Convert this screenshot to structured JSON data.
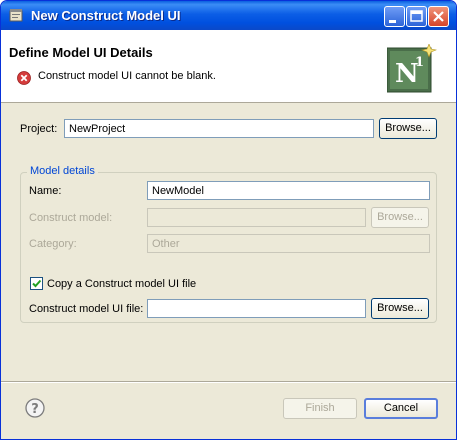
{
  "window": {
    "title": "New Construct Model UI"
  },
  "header": {
    "title": "Define Model UI Details",
    "error_message": "Construct model UI cannot be blank.",
    "wizard_image_text": "N",
    "wizard_image_superscript": "1"
  },
  "project": {
    "label": "Project:",
    "value": "NewProject",
    "browse_label": "Browse..."
  },
  "model_details": {
    "group_label": "Model details",
    "name": {
      "label": "Name:",
      "value": "NewModel"
    },
    "construct_model": {
      "label": "Construct model:",
      "value": "",
      "browse_label": "Browse..."
    },
    "category": {
      "label": "Category:",
      "value": "Other"
    },
    "copy_checkbox": {
      "label": "Copy a Construct model UI file",
      "checked": true
    },
    "ui_file": {
      "label": "Construct model UI file:",
      "value": "",
      "browse_label": "Browse..."
    }
  },
  "footer": {
    "finish_label": "Finish",
    "cancel_label": "Cancel"
  },
  "colors": {
    "titlebar": "#0054e3",
    "error": "#d43b3b",
    "group_label": "#0046d5"
  }
}
